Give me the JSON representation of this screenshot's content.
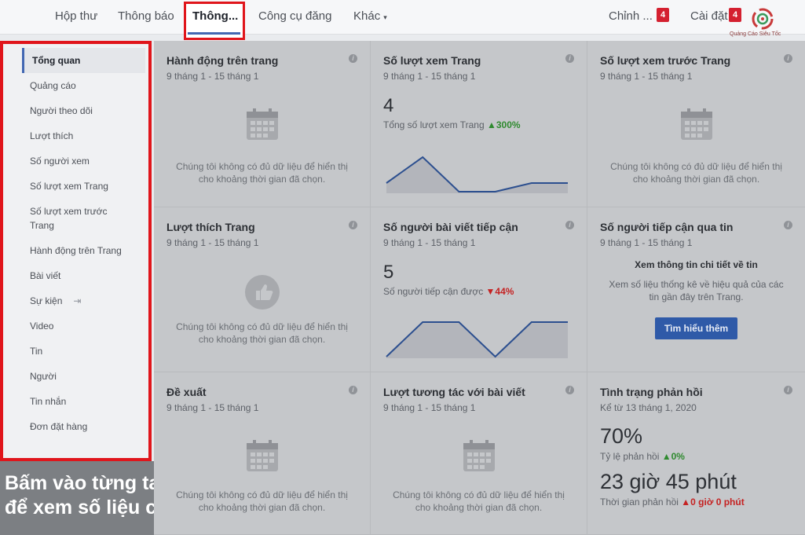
{
  "nav": {
    "tabs": [
      "Hộp thư",
      "Thông báo",
      "Thông...",
      "Công cụ đăng",
      "Khác"
    ],
    "right": [
      "Chỉnh ...",
      "Cài đặt"
    ],
    "badges": [
      "4",
      "4"
    ],
    "logo_text": "Quảng Cáo Siêu Tốc"
  },
  "sidebar": {
    "items": [
      "Tổng quan",
      "Quảng cáo",
      "Người theo dõi",
      "Lượt thích",
      "Số người xem",
      "Số lượt xem Trang",
      "Số lượt xem trước Trang",
      "Hành động trên Trang",
      "Bài viết",
      "Sự kiện",
      "Video",
      "Tin",
      "Người",
      "Tin nhắn",
      "Đơn đặt hàng"
    ]
  },
  "caption": {
    "line1": "Bấm vào từng tab",
    "line2": "để xem số liệu chi tiết"
  },
  "date_range": "9 tháng 1 - 15 tháng 1",
  "empty_msg": "Chúng tôi không có đủ dữ liệu để hiển thị cho khoảng thời gian đã chọn.",
  "cards": {
    "page_actions": {
      "title": "Hành động trên trang"
    },
    "page_views": {
      "title": "Số lượt xem Trang",
      "value": "4",
      "label": "Tổng số lượt xem Trang",
      "change": "▲300%",
      "sparkline": [
        1,
        4,
        0,
        0,
        1,
        1
      ]
    },
    "page_previews": {
      "title": "Số lượt xem trước Trang"
    },
    "page_likes": {
      "title": "Lượt thích Trang"
    },
    "post_reach": {
      "title": "Số người bài viết tiếp cận",
      "value": "5",
      "label": "Số người tiếp cận được",
      "change": "▼44%",
      "sparkline": [
        0,
        1,
        1,
        0,
        1,
        1
      ]
    },
    "story_reach": {
      "title": "Số người tiếp cận qua tin",
      "promo_title": "Xem thông tin chi tiết về tin",
      "promo_desc": "Xem số liệu thống kê về hiệu quả của các tin gần đây trên Trang.",
      "button": "Tìm hiểu thêm"
    },
    "recommendations": {
      "title": "Đề xuất"
    },
    "post_engagement": {
      "title": "Lượt tương tác với bài viết"
    },
    "response": {
      "title": "Tình trạng phản hồi",
      "subtitle": "Kể từ 13 tháng 1, 2020",
      "rate_value": "70%",
      "rate_label": "Tỷ lệ phản hồi",
      "rate_change": "▲0%",
      "time_value": "23 giờ 45 phút",
      "time_label": "Thời gian phản hồi",
      "time_change": "▲0 giờ 0 phút"
    }
  },
  "colors": {
    "accent": "#4267b2",
    "highlight": "#e0151b",
    "badge": "#d42030",
    "up": "#2f8a2f",
    "down": "#c52222"
  }
}
